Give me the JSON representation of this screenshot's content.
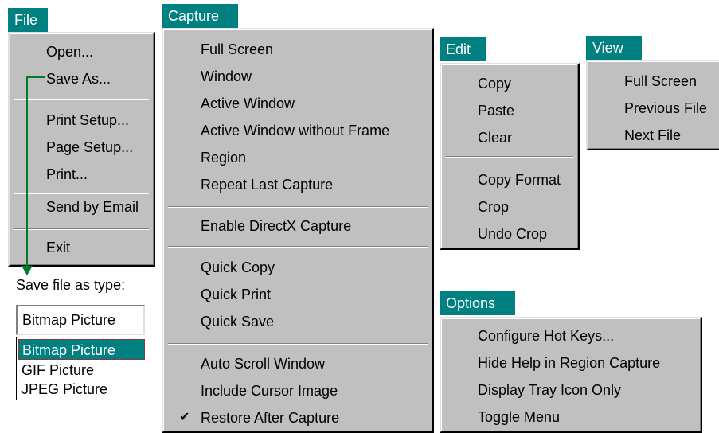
{
  "menus": {
    "file": {
      "title": "File",
      "items": [
        "Open...",
        "Save As...",
        "Print Setup...",
        "Page Setup...",
        "Print...",
        "Send by Email",
        "Exit"
      ]
    },
    "capture": {
      "title": "Capture",
      "items": [
        "Full Screen",
        "Window",
        "Active Window",
        "Active Window without Frame",
        "Region",
        "Repeat Last Capture",
        "Enable DirectX Capture",
        "Quick Copy",
        "Quick Print",
        "Quick Save",
        "Auto Scroll Window",
        "Include Cursor Image",
        "Restore After Capture"
      ],
      "checked_item": "Restore After Capture"
    },
    "edit": {
      "title": "Edit",
      "items": [
        "Copy",
        "Paste",
        "Clear",
        "Copy Format",
        "Crop",
        "Undo Crop"
      ]
    },
    "view": {
      "title": "View",
      "items": [
        "Full Screen",
        "Previous File",
        "Next File"
      ]
    },
    "options": {
      "title": "Options",
      "items": [
        "Configure Hot Keys...",
        "Hide Help in Region Capture",
        "Display Tray Icon Only",
        "Toggle Menu"
      ]
    }
  },
  "save_type": {
    "label": "Save file as type:",
    "current_value": "Bitmap Picture",
    "options": [
      "Bitmap Picture",
      "GIF Picture",
      "JPEG Picture"
    ],
    "selected_option": "Bitmap Picture"
  },
  "colors": {
    "menu_title_bg": "#008080",
    "menu_bg": "#c0c0c0",
    "arrow": "#007a2e"
  },
  "icons": {
    "check": "checkmark-icon"
  }
}
